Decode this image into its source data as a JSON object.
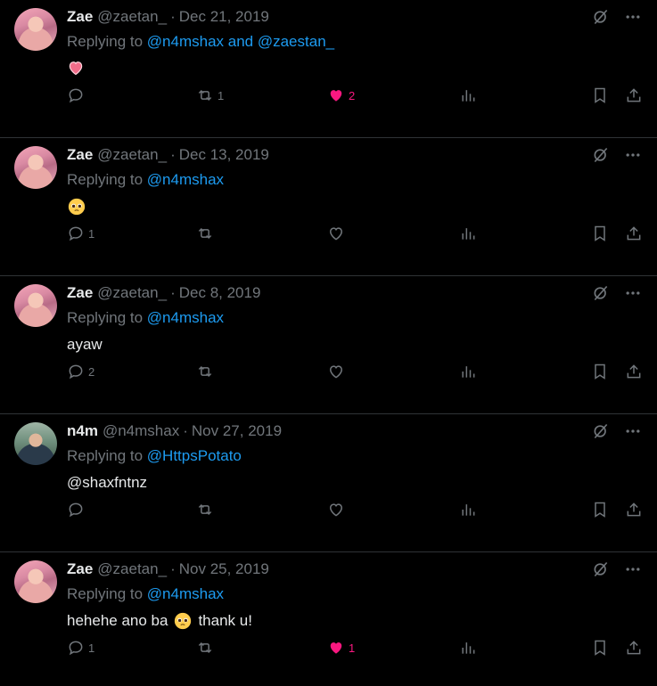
{
  "colors": {
    "background": "#000000",
    "link": "#1d9bf0",
    "muted": "#71767b",
    "like": "#f91880",
    "divider": "#2f3336"
  },
  "tweets": [
    {
      "name": "Zae",
      "handle": "@zaetan_",
      "sep": "·",
      "date": "Dec 21, 2019",
      "replying_prefix": "Replying to",
      "mentions": "@n4mshax and @zaestan_",
      "text": "",
      "emoji": "heart",
      "replies": "",
      "retweets": "1",
      "likes": "2",
      "liked": true,
      "avatar": "zae"
    },
    {
      "name": "Zae",
      "handle": "@zaetan_",
      "sep": "·",
      "date": "Dec 13, 2019",
      "replying_prefix": "Replying to",
      "mentions": "@n4mshax",
      "text": "",
      "emoji": "pleading-face",
      "replies": "1",
      "retweets": "",
      "likes": "",
      "liked": false,
      "avatar": "zae"
    },
    {
      "name": "Zae",
      "handle": "@zaetan_",
      "sep": "·",
      "date": "Dec 8, 2019",
      "replying_prefix": "Replying to",
      "mentions": "@n4mshax",
      "text": "ayaw",
      "emoji": "",
      "replies": "2",
      "retweets": "",
      "likes": "",
      "liked": false,
      "avatar": "zae"
    },
    {
      "name": "n4m",
      "handle": "@n4mshax",
      "sep": "·",
      "date": "Nov 27, 2019",
      "replying_prefix": "Replying to",
      "mentions": "@HttpsPotato",
      "text": "@shaxfntnz",
      "emoji": "",
      "replies": "",
      "retweets": "",
      "likes": "",
      "liked": false,
      "avatar": "n4m"
    },
    {
      "name": "Zae",
      "handle": "@zaetan_",
      "sep": "·",
      "date": "Nov 25, 2019",
      "replying_prefix": "Replying to",
      "mentions": "@n4mshax",
      "text": "hehehe ano ba",
      "text_after": "thank u!",
      "emoji": "pleading-face",
      "replies": "1",
      "retweets": "",
      "likes": "1",
      "liked": true,
      "avatar": "zae"
    }
  ],
  "icons": {
    "grok": "grok-icon",
    "more": "more-icon",
    "reply": "reply-icon",
    "retweet": "retweet-icon",
    "like": "heart-icon",
    "views": "views-icon",
    "bookmark": "bookmark-icon",
    "share": "share-icon"
  }
}
